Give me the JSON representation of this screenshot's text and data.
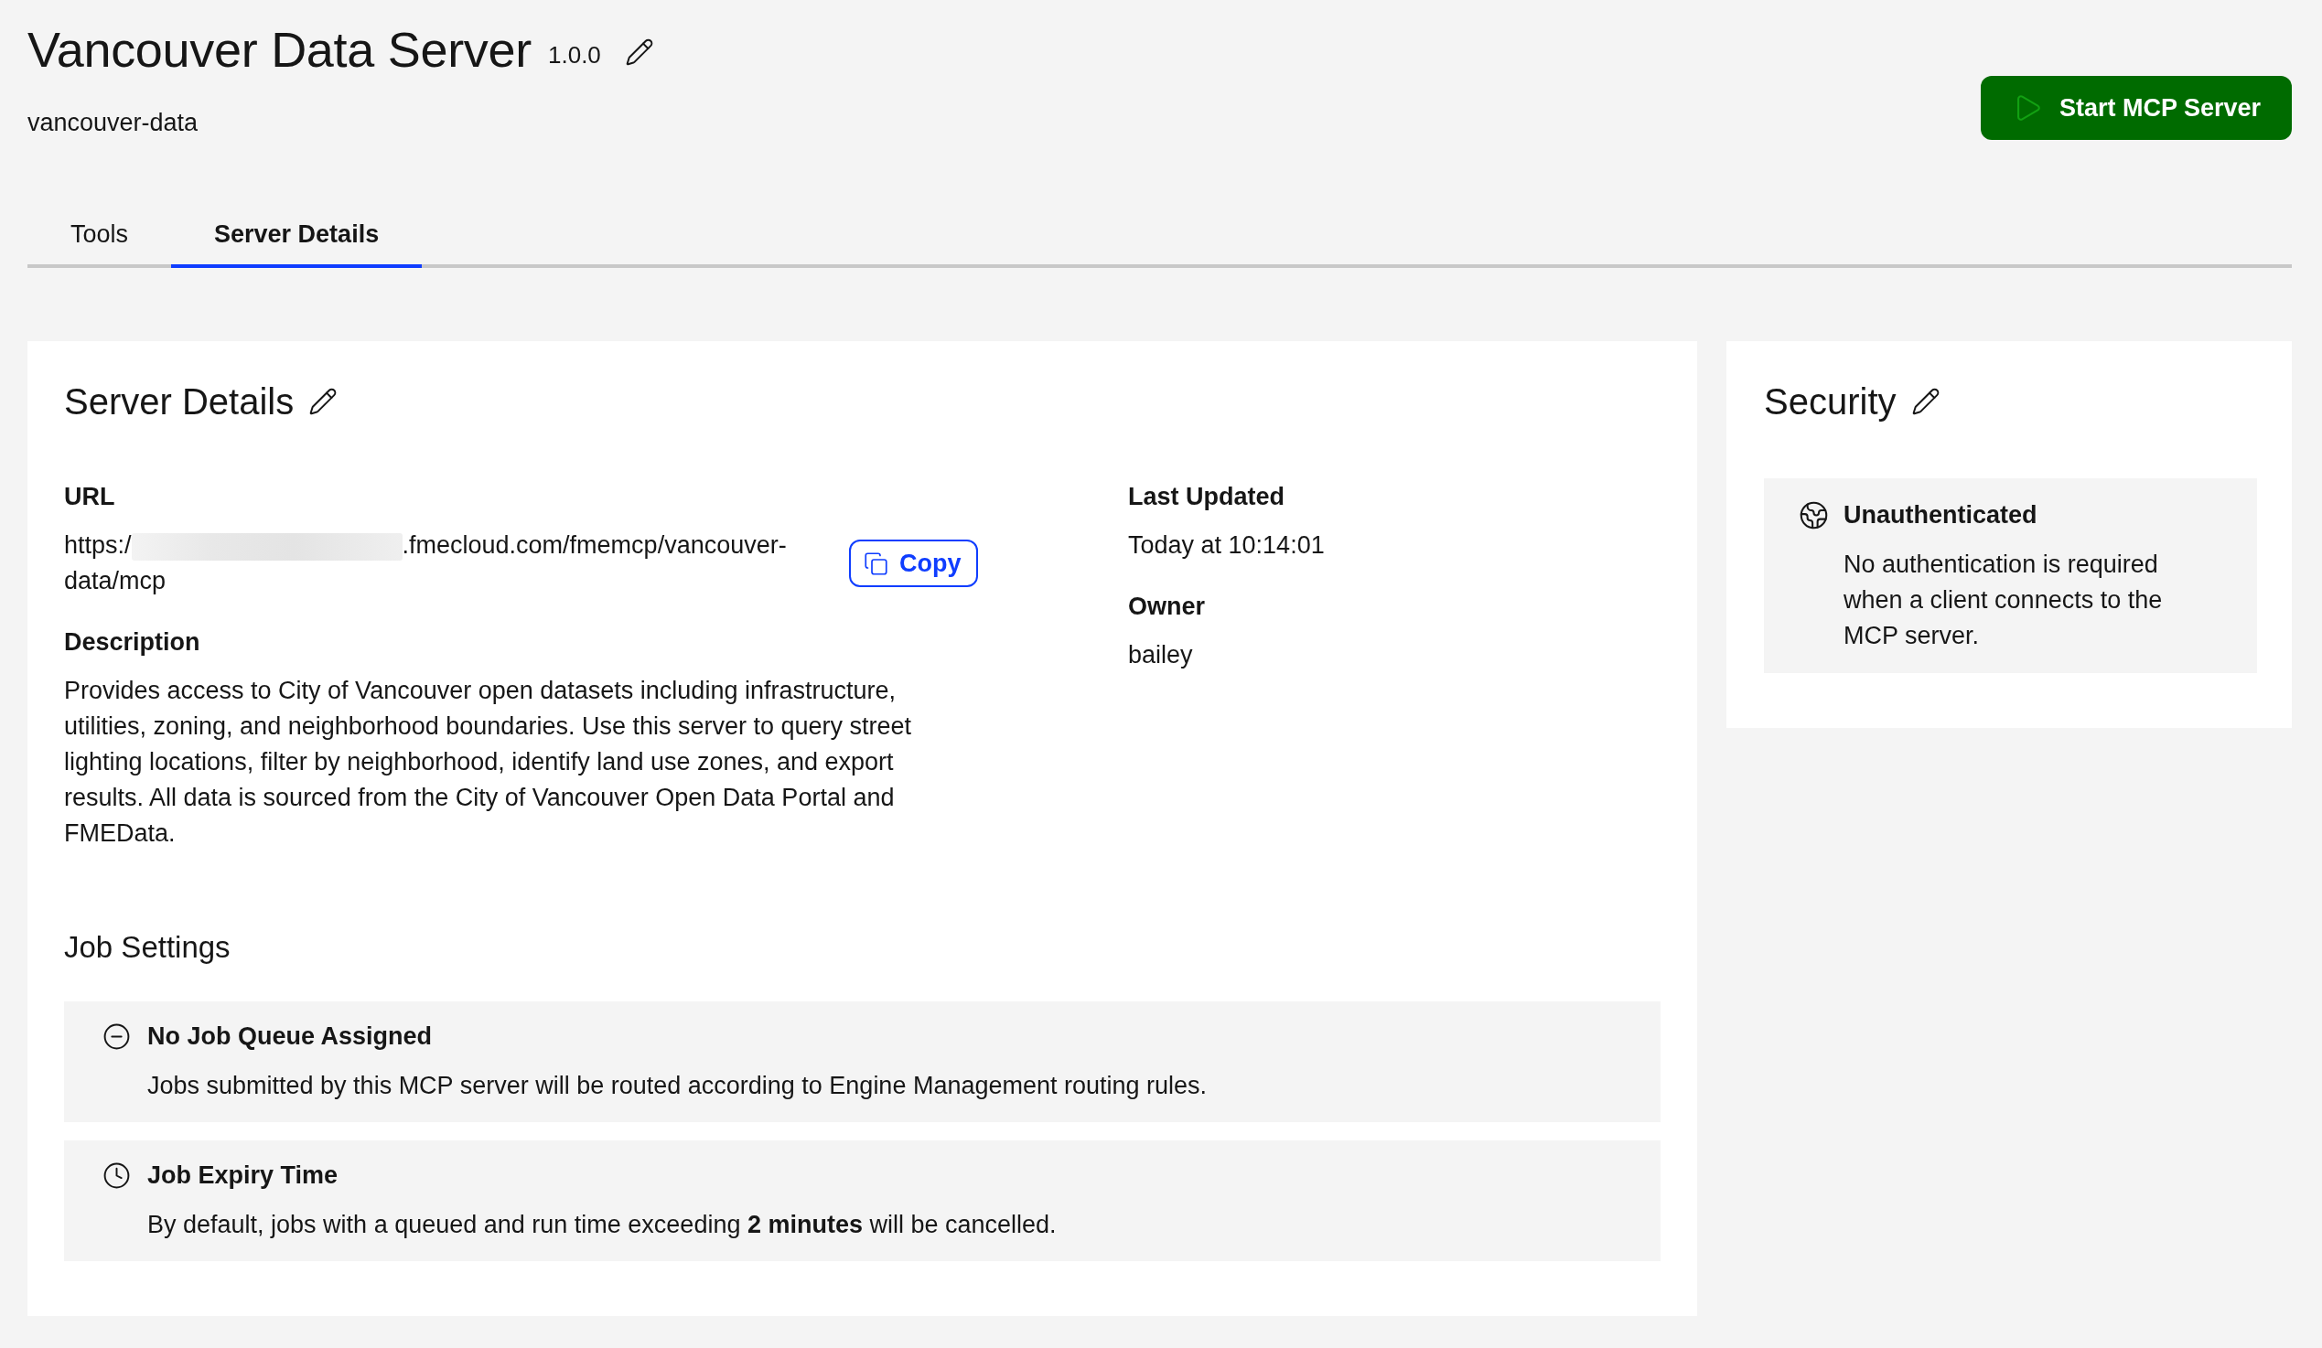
{
  "header": {
    "title": "Vancouver Data Server",
    "version": "1.0.0",
    "slug": "vancouver-data",
    "start_button": "Start MCP Server"
  },
  "tabs": [
    {
      "label": "Tools",
      "selected": false
    },
    {
      "label": "Server Details",
      "selected": true
    }
  ],
  "server_details": {
    "title": "Server Details",
    "url": {
      "label": "URL",
      "parts": [
        {
          "kind": "text",
          "text": "https:/"
        },
        {
          "kind": "redacted"
        },
        {
          "kind": "text",
          "text": ".fmecloud.com/fmemcp/vancouver-data/mcp"
        }
      ],
      "copy_button": "Copy"
    },
    "description": {
      "label": "Description",
      "text": "Provides access to City of Vancouver open datasets including infrastructure, utilities, zoning, and neighborhood boundaries. Use this server to query street lighting locations, filter by neighborhood, identify land use zones, and export results. All data is sourced from the City of Vancouver Open Data Portal and FMEData."
    },
    "last_updated": {
      "label": "Last Updated",
      "value": "Today at 10:14:01"
    },
    "owner": {
      "label": "Owner",
      "value": "bailey"
    },
    "job_settings": {
      "title": "Job Settings",
      "items": [
        {
          "kind": "queue",
          "title": "No Job Queue Assigned",
          "text": "Jobs submitted by this MCP server will be routed according to Engine Management routing rules."
        },
        {
          "kind": "expiry",
          "title": "Job Expiry Time",
          "text": "By default, jobs with a queued and run time exceeding **2 minutes** will be cancelled."
        }
      ]
    }
  },
  "security": {
    "title": "Security",
    "mode": {
      "kind": "unauthenticated",
      "title": "Unauthenticated",
      "text": "No authentication is required when a client connects to the MCP server."
    }
  }
}
